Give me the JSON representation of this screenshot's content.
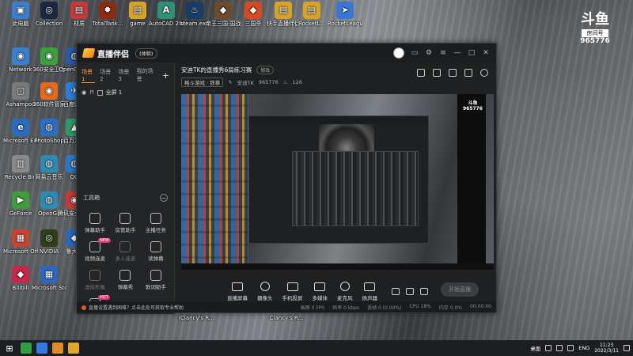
{
  "desktop": {
    "icons": [
      {
        "label": "此电脑",
        "color": "#3a7fd0",
        "glyph": "▣"
      },
      {
        "label": "Collection",
        "color": "#1b2940",
        "glyph": "◎"
      },
      {
        "label": "材质",
        "color": "#c23b3b",
        "glyph": "▤"
      },
      {
        "label": "TotalTank...",
        "color": "#8b2d12",
        "glyph": "✹"
      },
      {
        "label": "game",
        "color": "#d6a228",
        "glyph": "▤"
      },
      {
        "label": "AutoCAD 2007 - S...",
        "color": "#2f8f78",
        "glyph": "A"
      },
      {
        "label": "steam.exe",
        "color": "#1b3c65",
        "glyph": "♨"
      },
      {
        "label": "帝王三国·国战天下",
        "color": "#6b4a2f",
        "glyph": "◆"
      },
      {
        "label": "三国杀",
        "color": "#d34a25",
        "glyph": "◆"
      },
      {
        "label": "快手直播伴侣",
        "color": "#d9a22a",
        "glyph": "▤"
      },
      {
        "label": "RocketL...",
        "color": "#d9a22a",
        "glyph": "▤"
      },
      {
        "label": "RocketLeague",
        "color": "#3a76d6",
        "glyph": "➤"
      },
      {
        "label": "Network",
        "color": "#3a7fd0",
        "glyph": "◉"
      },
      {
        "label": "Ashampoo",
        "color": "#7a7a7a",
        "glyph": "▢"
      },
      {
        "label": "Microsoft Edge",
        "color": "#2b6bbd",
        "glyph": "e"
      },
      {
        "label": "Recycle Bin",
        "color": "#8a8a8a",
        "glyph": "▥"
      },
      {
        "label": "GeForce",
        "color": "#3f9d3a",
        "glyph": "▶"
      },
      {
        "label": "Microsoft Office",
        "color": "#c9432f",
        "glyph": "▦"
      },
      {
        "label": "Bilibili",
        "color": "#c4284a",
        "glyph": "◆"
      },
      {
        "label": "360安全卫士",
        "color": "#3aa23a",
        "glyph": "◉"
      },
      {
        "label": "360软件管家",
        "color": "#e56a1e",
        "glyph": "◉"
      },
      {
        "label": "PhotoShop",
        "color": "#2a6fc2",
        "glyph": "◍"
      },
      {
        "label": "网易云音乐",
        "color": "#2d8bb3",
        "glyph": "◍"
      },
      {
        "label": "OpenGL",
        "color": "#2d8bb3",
        "glyph": "◍"
      },
      {
        "label": "NVIDIA",
        "color": "#2f3d1a",
        "glyph": "◎"
      },
      {
        "label": "Microsoft Store",
        "color": "#2d67c2",
        "glyph": "▦"
      },
      {
        "label": "OpenOffice",
        "color": "#2b5aa8",
        "glyph": "◍"
      },
      {
        "label": "百度网盘",
        "color": "#2b7fd6",
        "glyph": "✈"
      },
      {
        "label": "百万游戏",
        "color": "#2f9a6a",
        "glyph": "▲"
      },
      {
        "label": "QQ",
        "color": "#2d77c9",
        "glyph": "◍"
      },
      {
        "label": "腾讯安全中心",
        "color": "#c83a3a",
        "glyph": "◉"
      },
      {
        "label": "鲁大师",
        "color": "#2b69b8",
        "glyph": "◆"
      }
    ],
    "below_window_labels": [
      "(Clancy's R...",
      "Clancy's R..."
    ]
  },
  "watermark": {
    "logo": "斗鱼",
    "room_label": "房间号",
    "room_number": "965776"
  },
  "app": {
    "brand": "直播伴侣",
    "beta": "(体验)",
    "window_controls": {
      "min": "—",
      "max": "□",
      "close": "✕"
    },
    "scene_tabs": [
      "场景1",
      "场景2",
      "场景3",
      "我的场景"
    ],
    "add_scene": "+",
    "layer_name": "全屏 1",
    "toolbox": {
      "title": "工具箱",
      "collapse": "—",
      "tools": [
        {
          "label": "弹幕助手",
          "dim": false,
          "tag": ""
        },
        {
          "label": "房管助手",
          "dim": false,
          "tag": ""
        },
        {
          "label": "主播任务",
          "dim": false,
          "tag": ""
        },
        {
          "label": "视频连麦",
          "dim": false,
          "tag": "NEW"
        },
        {
          "label": "多人连麦",
          "dim": true,
          "tag": ""
        },
        {
          "label": "读弹幕",
          "dim": false,
          "tag": ""
        },
        {
          "label": "虚拟形象",
          "dim": true,
          "tag": ""
        },
        {
          "label": "弹幕秀",
          "dim": false,
          "tag": ""
        },
        {
          "label": "歌词助手",
          "dim": false,
          "tag": ""
        },
        {
          "label": "",
          "dim": false,
          "tag": "HOT"
        }
      ]
    },
    "stream": {
      "title": "安迪TK的直播秀6局练习赛",
      "edit": "修改",
      "category": "格斗游戏 · 铁拳",
      "streamer": "安迪TK",
      "room": "965776",
      "fans": "126"
    },
    "preview_watermark": {
      "logo": "斗鱼",
      "room": "965776"
    },
    "controls": [
      {
        "label": "直播屏幕",
        "shape": "rect"
      },
      {
        "label": "摄像头",
        "shape": "round"
      },
      {
        "label": "手机投屏",
        "shape": "rect"
      },
      {
        "label": "多媒体",
        "shape": "rect"
      },
      {
        "label": "麦克风",
        "shape": "round"
      },
      {
        "label": "扬声器",
        "shape": "rect"
      }
    ],
    "start_button": "开始直播",
    "status": {
      "notice": "直播设置遇到困难？点击此处可获取专业帮助",
      "fps": "画面 0 FPS",
      "bitrate": "码率 0 kbps",
      "dropped": "丢帧 0 (0.00%)",
      "cpu": "CPU 18%",
      "memory": "内存 0.0%",
      "duration": "00:00:00"
    }
  },
  "taskbar": {
    "start_glyph": "⊞",
    "apps": [
      "#2ea043",
      "#2f7be0",
      "#e08a2a",
      "#e0a82a"
    ],
    "tray_text": "桌面",
    "lang": "ENG",
    "time": "11:23",
    "date": "2022/3/11"
  }
}
